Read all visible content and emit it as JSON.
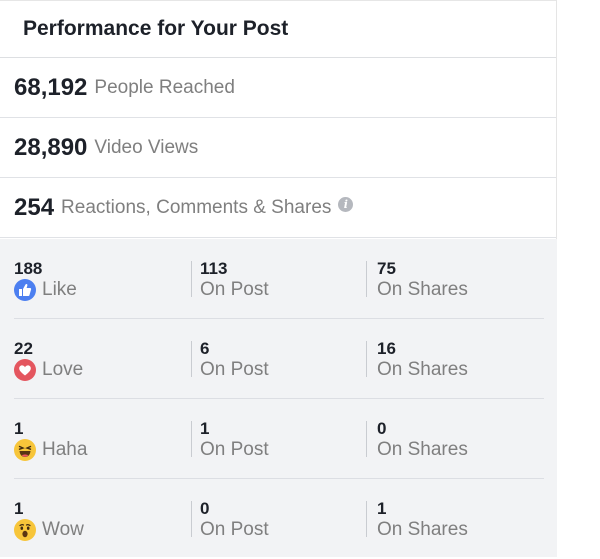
{
  "header": {
    "title": "Performance for Your Post"
  },
  "stats": [
    {
      "value": "68,192",
      "label": "People Reached"
    },
    {
      "value": "28,890",
      "label": "Video Views"
    },
    {
      "value": "254",
      "label": "Reactions, Comments & Shares"
    }
  ],
  "info_icon_glyph": "i",
  "reactions": [
    {
      "icon": "like-icon",
      "count": "188",
      "label": "Like",
      "on_post": "113",
      "on_post_label": "On Post",
      "on_shares": "75",
      "on_shares_label": "On Shares"
    },
    {
      "icon": "love-icon",
      "count": "22",
      "label": "Love",
      "on_post": "6",
      "on_post_label": "On Post",
      "on_shares": "16",
      "on_shares_label": "On Shares"
    },
    {
      "icon": "haha-icon",
      "count": "1",
      "label": "Haha",
      "on_post": "1",
      "on_post_label": "On Post",
      "on_shares": "0",
      "on_shares_label": "On Shares"
    },
    {
      "icon": "wow-icon",
      "count": "1",
      "label": "Wow",
      "on_post": "0",
      "on_post_label": "On Post",
      "on_shares": "1",
      "on_shares_label": "On Shares"
    }
  ],
  "colors": {
    "like": "#4c7ff0",
    "love": "#e4565f",
    "emoji": "#f7c53a",
    "label_gray": "#7f7f7f",
    "breakdown_bg": "#f2f3f5"
  }
}
